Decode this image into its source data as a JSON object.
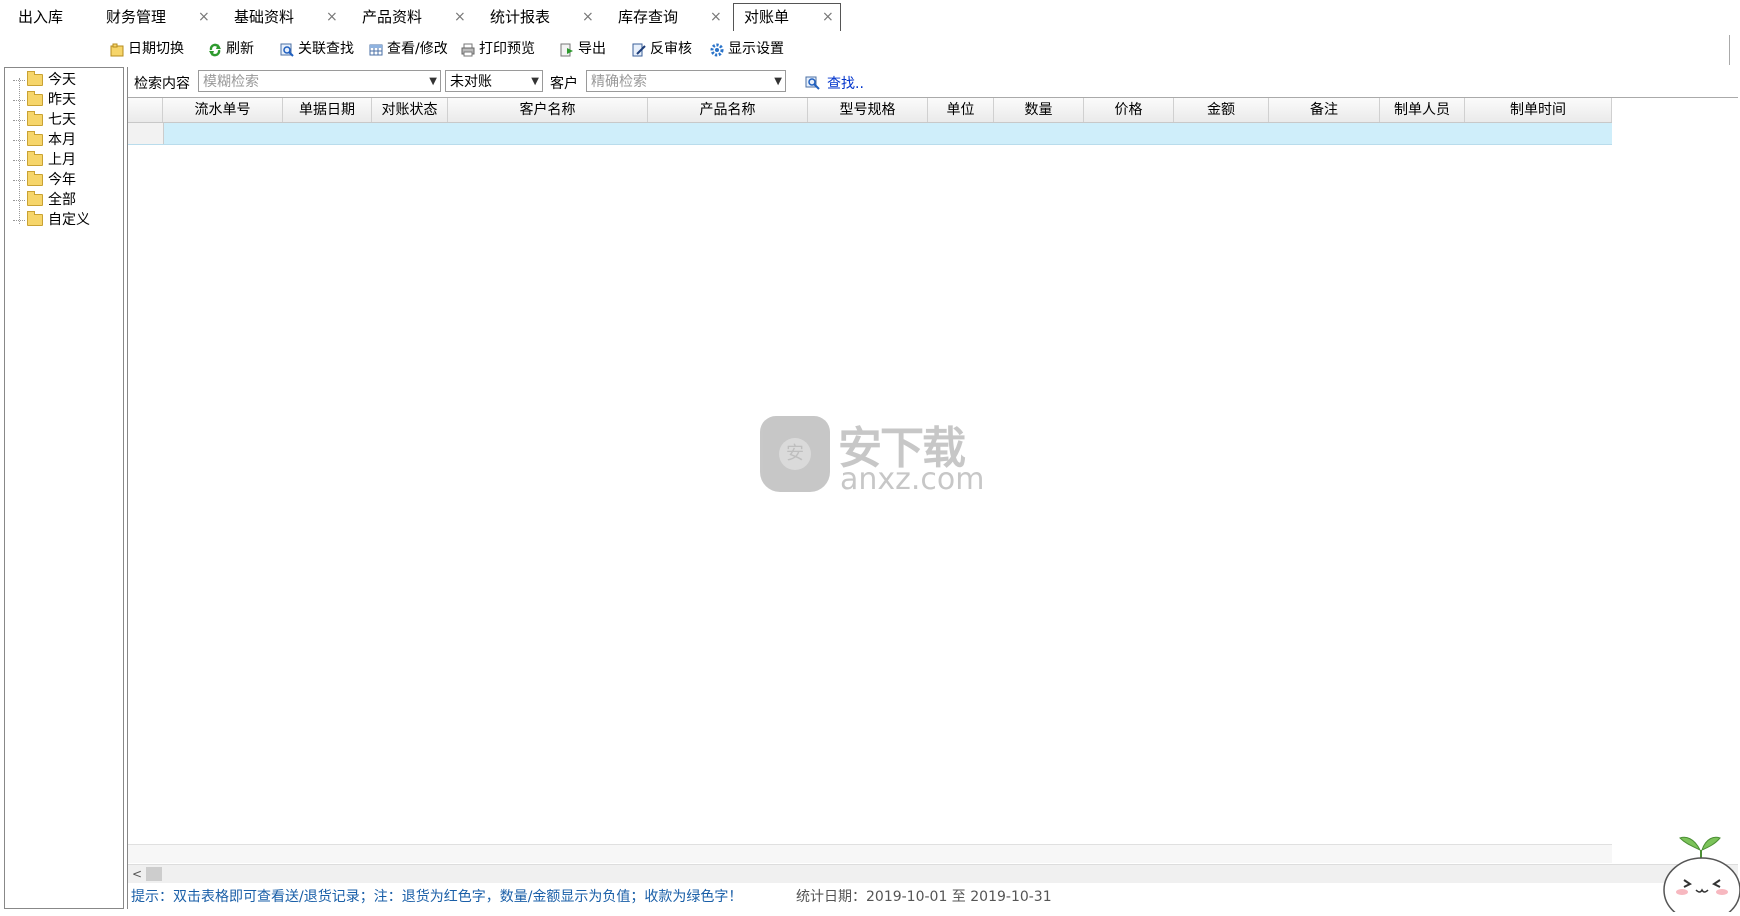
{
  "tabs": [
    {
      "label": "出入库",
      "closable": false,
      "active": false
    },
    {
      "label": "财务管理",
      "closable": true,
      "active": false
    },
    {
      "label": "基础资料",
      "closable": true,
      "active": false
    },
    {
      "label": "产品资料",
      "closable": true,
      "active": false
    },
    {
      "label": "统计报表",
      "closable": true,
      "active": false
    },
    {
      "label": "库存查询",
      "closable": true,
      "active": false
    },
    {
      "label": "对账单",
      "closable": true,
      "active": true
    }
  ],
  "close_glyph": "×",
  "toolbar": {
    "date_switch": "日期切换",
    "refresh": "刷新",
    "linked_search": "关联查找",
    "view_edit": "查看/修改",
    "print_preview": "打印预览",
    "export": "导出",
    "unaudit": "反审核",
    "display_settings": "显示设置"
  },
  "tree": {
    "items": [
      "今天",
      "昨天",
      "七天",
      "本月",
      "上月",
      "今年",
      "全部",
      "自定义"
    ]
  },
  "filter": {
    "search_label": "检索内容",
    "fuzzy_placeholder": "模糊检索",
    "status_value": "未对账",
    "customer_label": "客户",
    "exact_placeholder": "精确检索",
    "find_link": "查找.."
  },
  "grid": {
    "columns": [
      "流水单号",
      "单据日期",
      "对账状态",
      "客户名称",
      "产品名称",
      "型号规格",
      "单位",
      "数量",
      "价格",
      "金额",
      "备注",
      "制单人员",
      "制单时间"
    ]
  },
  "status": {
    "hint": "提示：双击表格即可查看送/退货记录；注：退货为红色字，数量/金额显示为负值；收款为绿色字！",
    "stat_date": "统计日期：2019-10-01 至 2019-10-31"
  },
  "watermark": {
    "cn": "安下载",
    "en": "anxz.com"
  },
  "colors": {
    "selected_row": "#cfeefa",
    "hint_text": "#1a5fa8",
    "link": "#0033cc"
  }
}
